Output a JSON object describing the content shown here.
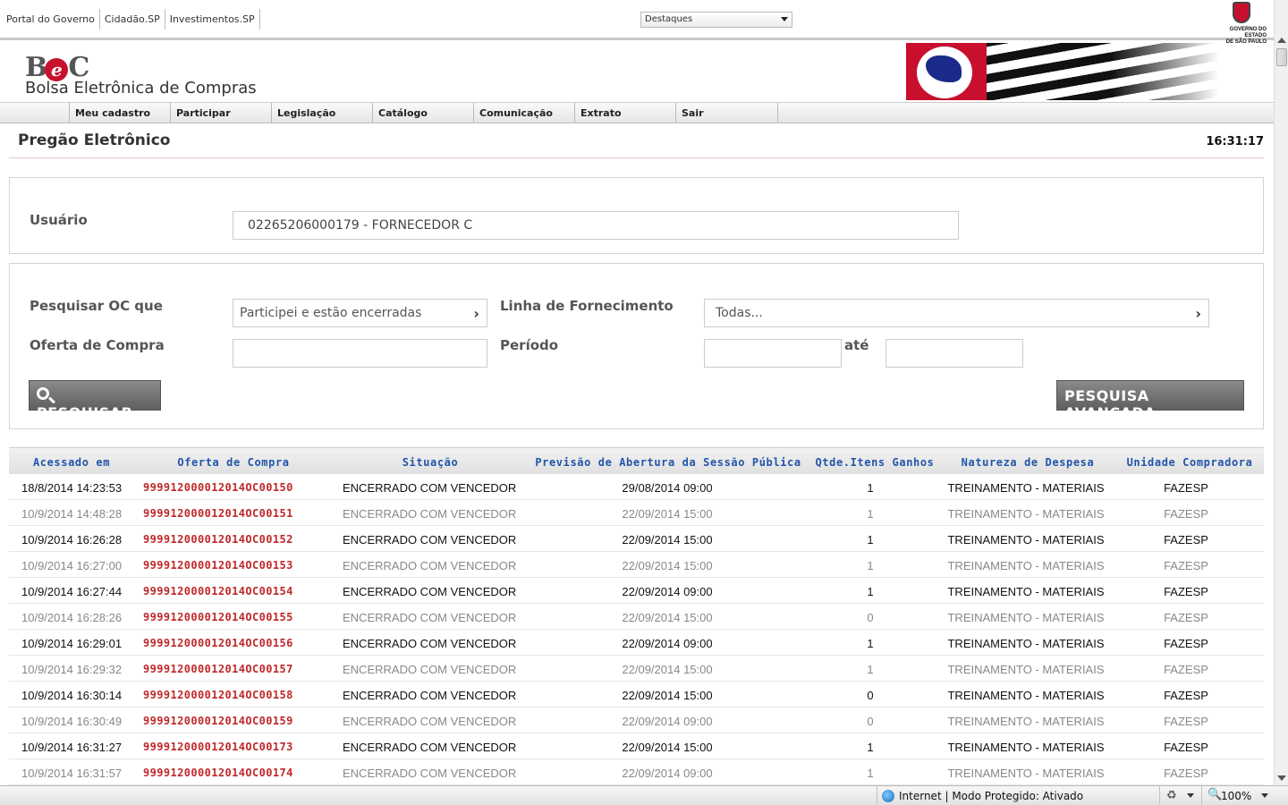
{
  "gov_links": [
    "Portal do Governo",
    "Cidadão.SP",
    "Investimentos.SP"
  ],
  "destaques_select": "Destaques",
  "gov_logo_text": [
    "GOVERNO DO ESTADO",
    "DE SÃO PAULO"
  ],
  "brand": {
    "logo_mark": "BeC",
    "name": "Bolsa Eletrônica de Compras"
  },
  "nav": [
    "Meu cadastro",
    "Participar",
    "Legislação",
    "Catálogo",
    "Comunicação",
    "Extrato",
    "Sair"
  ],
  "page_title": "Pregão Eletrônico",
  "clock": "16:31:17",
  "user_panel": {
    "label": "Usuário",
    "value": "02265206000179 - FORNECEDOR C"
  },
  "search": {
    "pesquisar_oc_label": "Pesquisar OC que",
    "pesquisar_oc_value": "Participei e estão encerradas",
    "linha_label": "Linha de Fornecimento",
    "linha_value": "Todas...",
    "oferta_label": "Oferta de Compra",
    "oferta_value": "",
    "periodo_label": "Período",
    "ate_label": "até",
    "periodo_inicio": "",
    "periodo_fim": "",
    "search_button": "PESQUISAR",
    "advanced_button": "PESQUISA AVANÇADA.."
  },
  "table": {
    "headers": [
      "Acessado em",
      "Oferta de Compra",
      "Situação",
      "Previsão de Abertura da Sessão Pública",
      "Qtde.Itens Ganhos",
      "Natureza de Despesa",
      "Unidade Compradora"
    ],
    "rows": [
      [
        "18/8/2014 14:23:53",
        "999912000012014OC00150",
        "ENCERRADO COM VENCEDOR",
        "29/08/2014 09:00",
        "1",
        "TREINAMENTO - MATERIAIS",
        "FAZESP"
      ],
      [
        "10/9/2014 14:48:28",
        "999912000012014OC00151",
        "ENCERRADO COM VENCEDOR",
        "22/09/2014 15:00",
        "1",
        "TREINAMENTO - MATERIAIS",
        "FAZESP"
      ],
      [
        "10/9/2014 16:26:28",
        "999912000012014OC00152",
        "ENCERRADO COM VENCEDOR",
        "22/09/2014 15:00",
        "1",
        "TREINAMENTO - MATERIAIS",
        "FAZESP"
      ],
      [
        "10/9/2014 16:27:00",
        "999912000012014OC00153",
        "ENCERRADO COM VENCEDOR",
        "22/09/2014 15:00",
        "1",
        "TREINAMENTO - MATERIAIS",
        "FAZESP"
      ],
      [
        "10/9/2014 16:27:44",
        "999912000012014OC00154",
        "ENCERRADO COM VENCEDOR",
        "22/09/2014 09:00",
        "1",
        "TREINAMENTO - MATERIAIS",
        "FAZESP"
      ],
      [
        "10/9/2014 16:28:26",
        "999912000012014OC00155",
        "ENCERRADO COM VENCEDOR",
        "22/09/2014 15:00",
        "0",
        "TREINAMENTO - MATERIAIS",
        "FAZESP"
      ],
      [
        "10/9/2014 16:29:01",
        "999912000012014OC00156",
        "ENCERRADO COM VENCEDOR",
        "22/09/2014 09:00",
        "1",
        "TREINAMENTO - MATERIAIS",
        "FAZESP"
      ],
      [
        "10/9/2014 16:29:32",
        "999912000012014OC00157",
        "ENCERRADO COM VENCEDOR",
        "22/09/2014 15:00",
        "1",
        "TREINAMENTO - MATERIAIS",
        "FAZESP"
      ],
      [
        "10/9/2014 16:30:14",
        "999912000012014OC00158",
        "ENCERRADO COM VENCEDOR",
        "22/09/2014 15:00",
        "0",
        "TREINAMENTO - MATERIAIS",
        "FAZESP"
      ],
      [
        "10/9/2014 16:30:49",
        "999912000012014OC00159",
        "ENCERRADO COM VENCEDOR",
        "22/09/2014 09:00",
        "0",
        "TREINAMENTO - MATERIAIS",
        "FAZESP"
      ],
      [
        "10/9/2014 16:31:27",
        "999912000012014OC00173",
        "ENCERRADO COM VENCEDOR",
        "22/09/2014 15:00",
        "1",
        "TREINAMENTO - MATERIAIS",
        "FAZESP"
      ],
      [
        "10/9/2014 16:31:57",
        "999912000012014OC00174",
        "ENCERRADO COM VENCEDOR",
        "22/09/2014 09:00",
        "1",
        "TREINAMENTO - MATERIAIS",
        "FAZESP"
      ]
    ]
  },
  "statusbar": {
    "zone": "Internet | Modo Protegido: Ativado",
    "zoom": "100%"
  },
  "colors": {
    "link_blue": "#2255aa",
    "oc_red": "#c0282a",
    "button_gray": "#6e6e6e"
  }
}
